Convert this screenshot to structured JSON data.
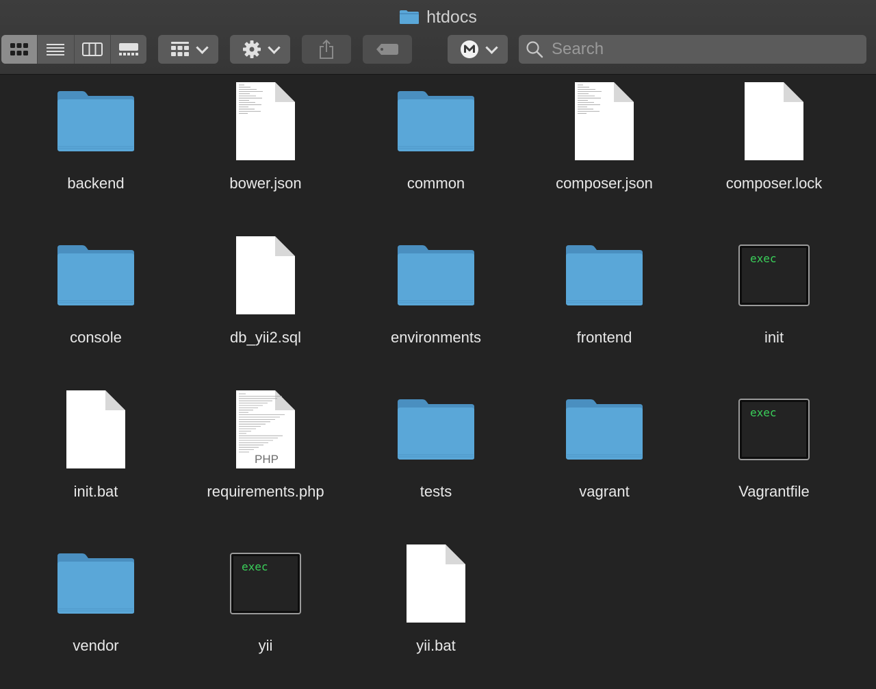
{
  "window": {
    "title": "htdocs"
  },
  "toolbar": {
    "view_modes": [
      {
        "name": "icon-view-button",
        "icon": "grid-icon",
        "active": true
      },
      {
        "name": "list-view-button",
        "icon": "list-icon",
        "active": false
      },
      {
        "name": "column-view-button",
        "icon": "columns-icon",
        "active": false
      },
      {
        "name": "gallery-view-button",
        "icon": "gallery-icon",
        "active": false
      }
    ],
    "search": {
      "placeholder": "Search"
    }
  },
  "items": [
    {
      "name": "backend",
      "type": "folder"
    },
    {
      "name": "bower.json",
      "type": "doc-text"
    },
    {
      "name": "common",
      "type": "folder"
    },
    {
      "name": "composer.json",
      "type": "doc-text"
    },
    {
      "name": "composer.lock",
      "type": "doc"
    },
    {
      "name": "console",
      "type": "folder"
    },
    {
      "name": "db_yii2.sql",
      "type": "doc"
    },
    {
      "name": "environments",
      "type": "folder"
    },
    {
      "name": "frontend",
      "type": "folder"
    },
    {
      "name": "init",
      "type": "exec",
      "label": "exec"
    },
    {
      "name": "init.bat",
      "type": "doc"
    },
    {
      "name": "requirements.php",
      "type": "doc-php",
      "label": "PHP"
    },
    {
      "name": "tests",
      "type": "folder"
    },
    {
      "name": "vagrant",
      "type": "folder"
    },
    {
      "name": "Vagrantfile",
      "type": "exec",
      "label": "exec"
    },
    {
      "name": "vendor",
      "type": "folder"
    },
    {
      "name": "yii",
      "type": "exec",
      "label": "exec"
    },
    {
      "name": "yii.bat",
      "type": "doc"
    }
  ],
  "colors": {
    "folder": "#5aa7d8",
    "folder_tab": "#4a8fc0",
    "exec_text": "#3ad05a",
    "background": "#232323"
  }
}
